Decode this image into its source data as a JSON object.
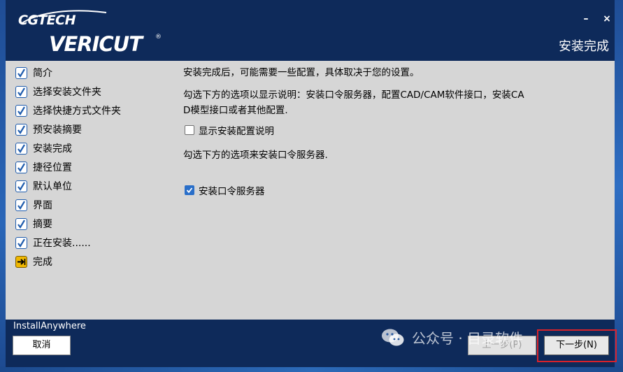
{
  "header": {
    "logo_top": "CGTECH",
    "logo_main": "VERICUT",
    "logo_reg": "®",
    "title": "安装完成",
    "minimize_label": "–",
    "close_label": "×"
  },
  "steps": [
    {
      "label": "简介",
      "state": "done"
    },
    {
      "label": "选择安装文件夹",
      "state": "done"
    },
    {
      "label": "选择快捷方式文件夹",
      "state": "done"
    },
    {
      "label": "预安装摘要",
      "state": "done"
    },
    {
      "label": "安装完成",
      "state": "done"
    },
    {
      "label": "捷径位置",
      "state": "done"
    },
    {
      "label": "默认单位",
      "state": "done"
    },
    {
      "label": "界面",
      "state": "done"
    },
    {
      "label": "摘要",
      "state": "done"
    },
    {
      "label": "正在安装......",
      "state": "done"
    },
    {
      "label": "完成",
      "state": "current"
    }
  ],
  "content": {
    "intro": "安装完成后，可能需要一些配置，具体取决于您的设置。",
    "explain_line1": "勾选下方的选项以显示说明：安装口令服务器，配置CAD/CAM软件接口，安装CA",
    "explain_line2": "D模型接口或者其他配置.",
    "show_config_label": "显示安装配置说明",
    "show_config_checked": false,
    "license_prompt": "勾选下方的选项来安装口令服务器.",
    "license_label": "安装口令服务器",
    "license_checked": true
  },
  "footer": {
    "vendor": "InstallAnywhere",
    "cancel_label": "取消",
    "prev_label": "上一步(P)",
    "next_label": "下一步(N)"
  },
  "watermark": {
    "text": "公众号 · 目录软件"
  },
  "colors": {
    "header_bg": "#0e2a5a",
    "panel_bg": "#d6d6d6",
    "check_blue": "#1f5cad",
    "current_step_yellow": "#f0b800",
    "highlight_red": "#d9222a"
  }
}
